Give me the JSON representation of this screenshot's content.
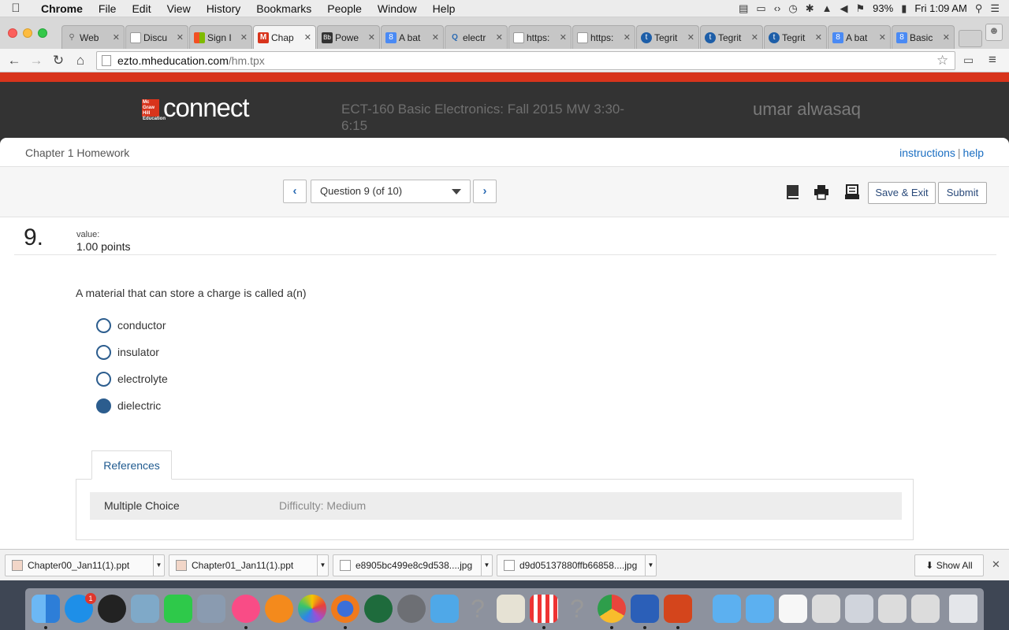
{
  "menubar": {
    "app": "Chrome",
    "items": [
      "File",
      "Edit",
      "View",
      "History",
      "Bookmarks",
      "People",
      "Window",
      "Help"
    ],
    "battery": "93%",
    "clock": "Fri 1:09 AM"
  },
  "tabs": [
    {
      "label": "Web",
      "favicon": "search"
    },
    {
      "label": "Discu",
      "favicon": "doc"
    },
    {
      "label": "Sign I",
      "favicon": "microsoft"
    },
    {
      "label": "Chap",
      "favicon": "mcgraw"
    },
    {
      "label": "Powe",
      "favicon": "blackboard"
    },
    {
      "label": "A bat",
      "favicon": "google"
    },
    {
      "label": "electr",
      "favicon": "quizlet"
    },
    {
      "label": "https:",
      "favicon": "doc"
    },
    {
      "label": "https:",
      "favicon": "doc"
    },
    {
      "label": "Tegrit",
      "favicon": "tegrity"
    },
    {
      "label": "Tegrit",
      "favicon": "tegrity"
    },
    {
      "label": "Tegrit",
      "favicon": "tegrity"
    },
    {
      "label": "A bat",
      "favicon": "google"
    },
    {
      "label": "Basic",
      "favicon": "google"
    }
  ],
  "address": {
    "host": "ezto.mheducation.com",
    "path": "/hm.tpx"
  },
  "header": {
    "logo_text": "connect",
    "logo_badge": "Mc Graw Hill Education",
    "course": "ECT-160 Basic Electronics: Fall 2015 MW 3:30-6:15",
    "user": "umar alwasaq"
  },
  "page": {
    "chapter": "Chapter 1 Homework",
    "instructions": "instructions",
    "help": "help",
    "question_select": "Question 9 (of 10)",
    "save_exit": "Save & Exit",
    "submit": "Submit"
  },
  "question": {
    "number": "9.",
    "value_label": "value:",
    "points": "1.00 points",
    "text": "A material that can store a charge is called a(n)",
    "options": [
      {
        "label": "conductor",
        "selected": false
      },
      {
        "label": "insulator",
        "selected": false
      },
      {
        "label": "electrolyte",
        "selected": false
      },
      {
        "label": "dielectric",
        "selected": true
      }
    ]
  },
  "references": {
    "tab": "References",
    "type": "Multiple Choice",
    "difficulty": "Difficulty: Medium"
  },
  "downloads": {
    "items": [
      "Chapter00_Jan11(1).ppt",
      "Chapter01_Jan11(1).ppt",
      "e8905bc499e8c9d538....jpg",
      "d9d05137880ffb66858....jpg"
    ],
    "show_all": "Show All"
  },
  "colors": {
    "accent": "#2c5d8e",
    "brand_red": "#d8341c",
    "header_bg": "#333333",
    "link": "#1a6ec2"
  }
}
